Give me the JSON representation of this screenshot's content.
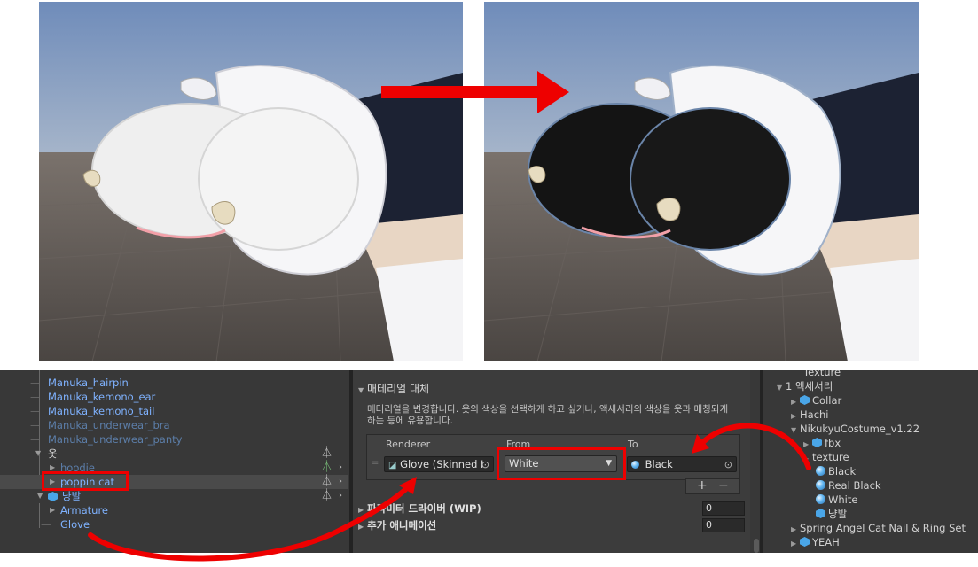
{
  "hierarchy": {
    "items": [
      {
        "label": "Manuka_hairpin",
        "style": "blue"
      },
      {
        "label": "Manuka_kemono_ear",
        "style": "blue"
      },
      {
        "label": "Manuka_kemono_tail",
        "style": "blue"
      },
      {
        "label": "Manuka_underwear_bra",
        "style": "dim"
      },
      {
        "label": "Manuka_underwear_panty",
        "style": "dim"
      },
      {
        "label": "옷",
        "style": "white"
      },
      {
        "label": "hoodie",
        "style": "dim"
      },
      {
        "label": "poppin cat",
        "style": "blue"
      },
      {
        "label": "냥발",
        "style": "blue"
      },
      {
        "label": "Armature",
        "style": "blue"
      },
      {
        "label": "Glove",
        "style": "blue"
      }
    ]
  },
  "inspector": {
    "section_title": "매테리얼 대체",
    "description": "매터리얼을 변경합니다. 옷의 색상을 선택하게 하고 싶거나, 액세서리의 색상을 옷과 매칭되게 하는 등에 유용합니다.",
    "columns": {
      "renderer": "Renderer",
      "from": "From",
      "to": "To"
    },
    "row": {
      "renderer": "Glove (Skinned I",
      "from": "White",
      "to": "Black"
    },
    "add_label": "+",
    "remove_label": "−",
    "param_driver_label": "파라미터 드라이버 (WIP)",
    "param_driver_value": "0",
    "extra_anim_label": "추가 애니메이션",
    "extra_anim_value": "0"
  },
  "project": {
    "items": [
      {
        "label": "Texture",
        "icon": "none"
      },
      {
        "label": "1 액세서리",
        "icon": "none"
      },
      {
        "label": "Collar",
        "icon": "cube-icon"
      },
      {
        "label": "Hachi",
        "icon": "none"
      },
      {
        "label": "NikukyuCostume_v1.22",
        "icon": "none"
      },
      {
        "label": "fbx",
        "icon": "cube-icon"
      },
      {
        "label": "texture",
        "icon": "none"
      },
      {
        "label": "Black",
        "icon": "material-icon"
      },
      {
        "label": "Real Black",
        "icon": "material-icon"
      },
      {
        "label": "White",
        "icon": "material-icon"
      },
      {
        "label": "냥발",
        "icon": "cube-icon"
      },
      {
        "label": "Spring Angel Cat Nail & Ring Set",
        "icon": "none"
      },
      {
        "label": "YEAH",
        "icon": "cube-icon"
      }
    ]
  },
  "colors": {
    "annotation_red": "#ee0000",
    "glove_white": "#f2f2f2",
    "glove_black": "#151515",
    "sleeve": "#1c2233",
    "sky": "#7f99c4",
    "ground": "#5e5753"
  }
}
